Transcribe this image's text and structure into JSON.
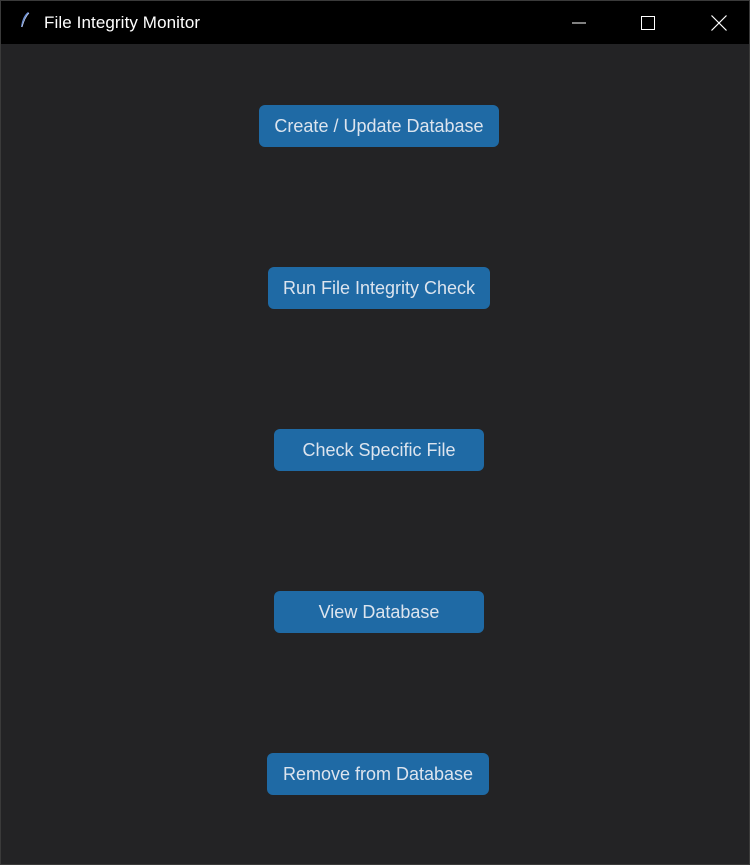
{
  "window": {
    "title": "File Integrity Monitor",
    "icon": "feather-icon"
  },
  "controls": {
    "minimize": "minimize-icon",
    "maximize": "maximize-icon",
    "close": "close-icon"
  },
  "actions": [
    {
      "label": "Create / Update Database"
    },
    {
      "label": "Run File Integrity Check"
    },
    {
      "label": "Check Specific File"
    },
    {
      "label": "View Database"
    },
    {
      "label": "Remove from Database"
    }
  ],
  "colors": {
    "titlebar": "#000000",
    "background": "#232325",
    "button": "#1f6aa5",
    "button_text": "#dce4ee"
  }
}
